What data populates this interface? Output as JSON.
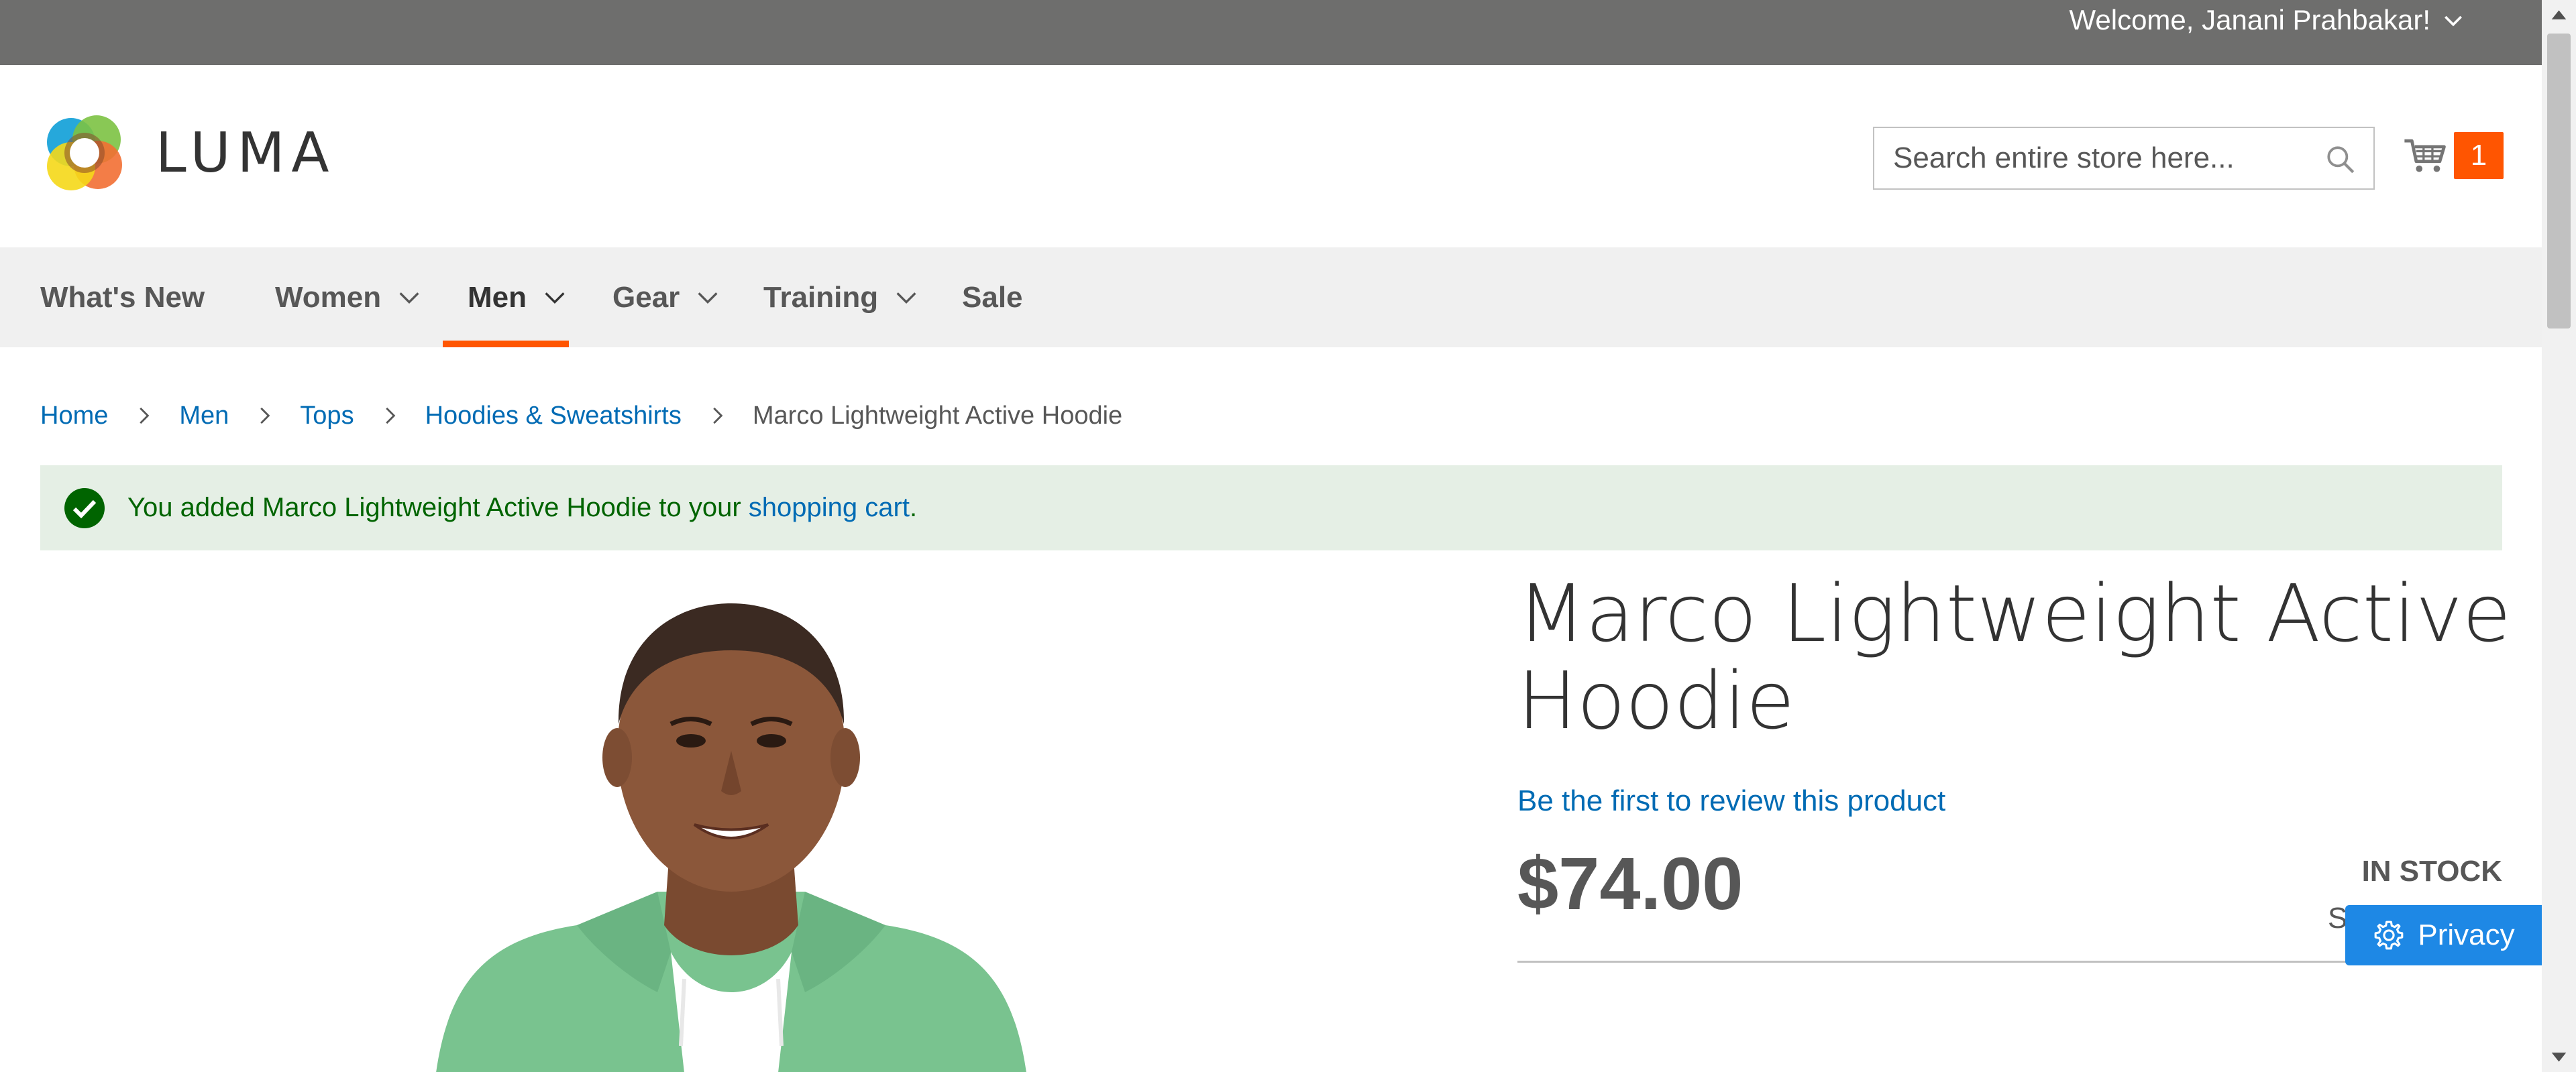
{
  "top_panel": {
    "welcome_text": "Welcome, Janani Prahbakar!"
  },
  "header": {
    "logo_text": "LUMA",
    "search": {
      "placeholder": "Search entire store here..."
    },
    "cart": {
      "count": "1"
    }
  },
  "nav": {
    "items": [
      {
        "label": "What's New",
        "has_dropdown": false
      },
      {
        "label": "Women",
        "has_dropdown": true
      },
      {
        "label": "Men",
        "has_dropdown": true,
        "active": true
      },
      {
        "label": "Gear",
        "has_dropdown": true
      },
      {
        "label": "Training",
        "has_dropdown": true
      },
      {
        "label": "Sale",
        "has_dropdown": false
      }
    ]
  },
  "breadcrumbs": [
    {
      "label": "Home",
      "link": true
    },
    {
      "label": "Men",
      "link": true
    },
    {
      "label": "Tops",
      "link": true
    },
    {
      "label": "Hoodies & Sweatshirts",
      "link": true
    },
    {
      "label": "Marco Lightweight Active Hoodie",
      "link": false
    }
  ],
  "message": {
    "text_before": "You added Marco Lightweight Active Hoodie to your ",
    "link_text": "shopping cart",
    "text_after": "."
  },
  "product": {
    "title": "Marco Lightweight Active Hoodie",
    "review_link": "Be the first to review this product",
    "price": "$74.00",
    "stock": "In stock",
    "sku_partial": "S"
  },
  "privacy": {
    "label": "Privacy"
  },
  "colors": {
    "accent_orange": "#ff5501",
    "link_blue": "#006bb4",
    "success_bg": "#e5efe5",
    "success_text": "#006400",
    "privacy_blue": "#1e88e5",
    "top_panel_bg": "#6e6e6d",
    "nav_bg": "#f0f0f0"
  },
  "icons": [
    "chevron-down-icon",
    "search-icon",
    "cart-icon",
    "chevron-right-icon",
    "check-circle-icon",
    "gear-icon",
    "luma-logo-icon"
  ]
}
